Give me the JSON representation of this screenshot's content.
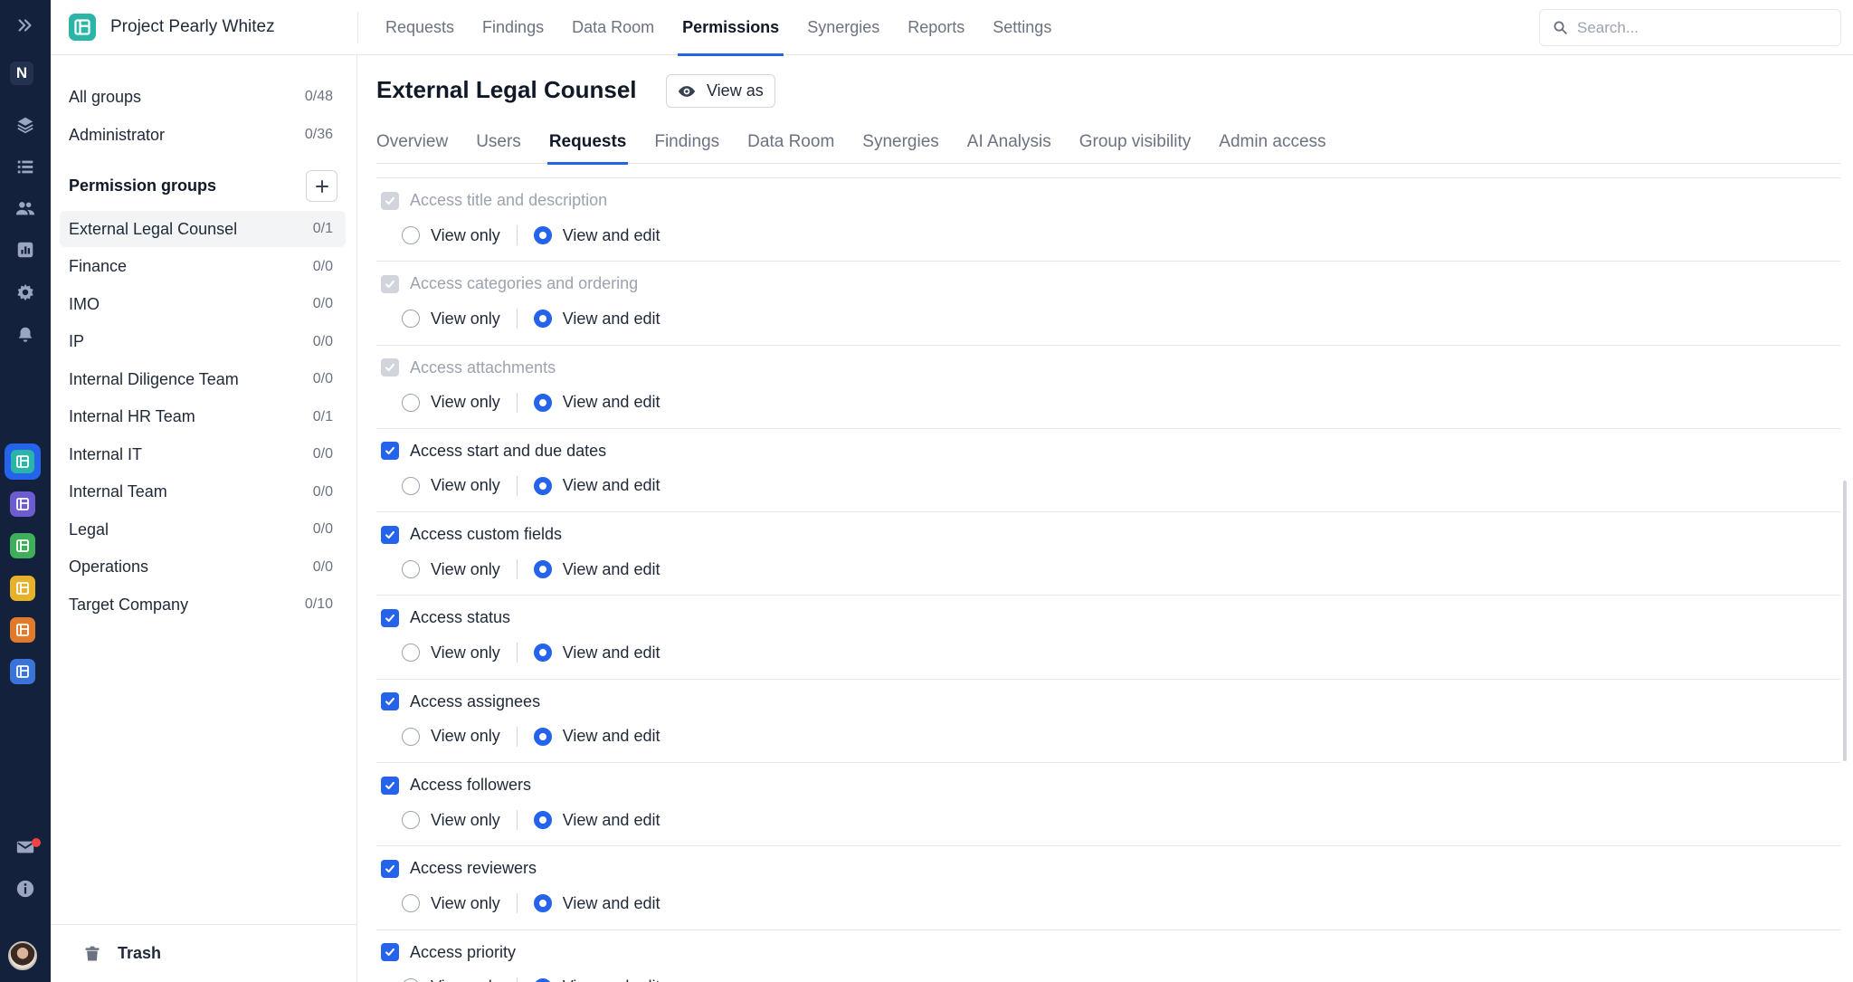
{
  "rail": {
    "user_initial": "N",
    "icons": [
      "expand-icon",
      "layers-icon",
      "list-icon",
      "users-icon",
      "chart-icon",
      "gear-icon",
      "bell-icon",
      "mail-icon",
      "info-icon"
    ],
    "workspace_colors": [
      "#2bb5a8",
      "#6d5bd0",
      "#3fae5a",
      "#e7b12b",
      "#e07a2c",
      "#3b74d8"
    ]
  },
  "header": {
    "project_name": "Project Pearly Whitez",
    "nav": [
      "Requests",
      "Findings",
      "Data Room",
      "Permissions",
      "Synergies",
      "Reports",
      "Settings"
    ],
    "active_nav": "Permissions",
    "search_placeholder": "Search..."
  },
  "sidebar": {
    "top_items": [
      {
        "label": "All groups",
        "count": "0/48"
      },
      {
        "label": "Administrator",
        "count": "0/36"
      }
    ],
    "groups_title": "Permission groups",
    "groups": [
      {
        "label": "External Legal Counsel",
        "count": "0/1"
      },
      {
        "label": "Finance",
        "count": "0/0"
      },
      {
        "label": "IMO",
        "count": "0/0"
      },
      {
        "label": "IP",
        "count": "0/0"
      },
      {
        "label": "Internal Diligence Team",
        "count": "0/0"
      },
      {
        "label": "Internal HR Team",
        "count": "0/1"
      },
      {
        "label": "Internal IT",
        "count": "0/0"
      },
      {
        "label": "Internal Team",
        "count": "0/0"
      },
      {
        "label": "Legal",
        "count": "0/0"
      },
      {
        "label": "Operations",
        "count": "0/0"
      },
      {
        "label": "Target Company",
        "count": "0/10"
      }
    ],
    "trash_label": "Trash"
  },
  "main": {
    "title": "External Legal Counsel",
    "view_as_label": "View as",
    "tabs": [
      "Overview",
      "Users",
      "Requests",
      "Findings",
      "Data Room",
      "Synergies",
      "AI Analysis",
      "Group visibility",
      "Admin access"
    ],
    "active_tab": "Requests",
    "radio_labels": {
      "view_only": "View only",
      "view_edit": "View and edit"
    },
    "permissions": [
      {
        "title": "Access title and description",
        "checked": true,
        "disabled": true,
        "mode": "edit"
      },
      {
        "title": "Access categories and ordering",
        "checked": true,
        "disabled": true,
        "mode": "edit"
      },
      {
        "title": "Access attachments",
        "checked": true,
        "disabled": true,
        "mode": "edit"
      },
      {
        "title": "Access start and due dates",
        "checked": true,
        "disabled": false,
        "mode": "edit"
      },
      {
        "title": "Access custom fields",
        "checked": true,
        "disabled": false,
        "mode": "edit"
      },
      {
        "title": "Access status",
        "checked": true,
        "disabled": false,
        "mode": "edit"
      },
      {
        "title": "Access assignees",
        "checked": true,
        "disabled": false,
        "mode": "edit"
      },
      {
        "title": "Access followers",
        "checked": true,
        "disabled": false,
        "mode": "edit"
      },
      {
        "title": "Access reviewers",
        "checked": true,
        "disabled": false,
        "mode": "edit"
      },
      {
        "title": "Access priority",
        "checked": true,
        "disabled": false,
        "mode": "edit"
      }
    ]
  },
  "colors": {
    "accent": "#2563eb",
    "rail_bg": "#14213d",
    "notification": "#ef4444"
  }
}
